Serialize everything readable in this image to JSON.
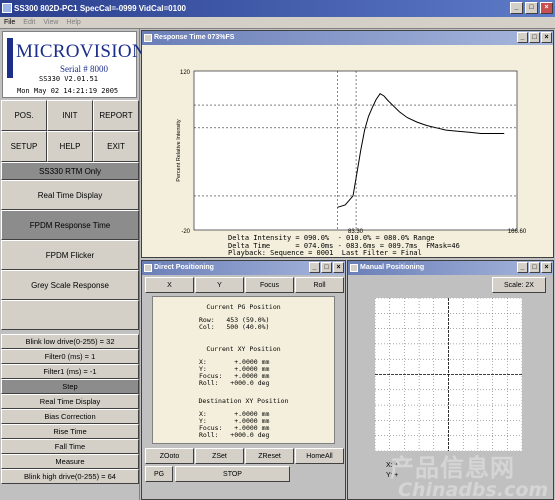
{
  "window": {
    "title": "SS300 802D-PC1  SpecCal=-0999 VidCal=0100"
  },
  "menu": [
    {
      "label": "File",
      "enabled": true
    },
    {
      "label": "Edit",
      "enabled": false
    },
    {
      "label": "View",
      "enabled": false
    },
    {
      "label": "Help",
      "enabled": false
    }
  ],
  "logo": {
    "brand": "MICROVISION",
    "serial": "Serial # 8000",
    "version": "SS330 V2.01.51",
    "datetime": "Mon May 02 14:21:19 2005"
  },
  "grid_buttons": [
    "POS.",
    "INIT",
    "REPORT",
    "SETUP",
    "HELP",
    "EXIT"
  ],
  "left_buttons": {
    "mode": "SS330 RTM Only",
    "realtime": "Real Time Display",
    "fpdm_response": "FPDM Response Time",
    "fpdm_flicker": "FPDM Flicker",
    "grey_scale": "Grey Scale Response",
    "blink_low": "Blink low drive(0-255) = 32",
    "filter0": "Filter0 (ms) = 1",
    "filter1": "Filter1 (ms) = -1",
    "step": "Step",
    "realtime2": "Real Time Display",
    "bias": "Bias Correction",
    "rise": "Rise Time",
    "fall": "Fall Time",
    "measure": "Measure",
    "blink_high": "Blink high drive(0-255) = 64"
  },
  "response_window": {
    "title": "Response Time  073%FS",
    "readout": [
      "Delta Intensity = 090.0%  - 010.0% = 080.0% Range",
      "Delta Time      = 074.0ms - 083.6ms = 009.7ms  FMask=46",
      "Playback: Sequence = 0001  Last Filter = Final"
    ]
  },
  "chart_data": {
    "type": "line",
    "title": "",
    "xlabel": "Time (milliseconds)",
    "ylabel": "Percent Relative Intensity",
    "xlim": [
      0,
      166.6
    ],
    "ylim": [
      -20,
      120
    ],
    "x_tick_labels": [
      "83.30",
      "166.60"
    ],
    "y_tick_labels": [
      "120",
      "-20"
    ],
    "reference_lines_y": [
      90,
      10,
      70
    ],
    "cursor_lines_x": [
      74,
      83.6
    ],
    "series": [
      {
        "x": [
          74,
          78,
          82,
          84,
          86,
          88,
          90,
          92,
          94,
          96,
          98,
          100,
          103,
          106,
          110,
          115,
          120,
          125,
          130,
          136,
          142,
          148,
          154,
          160
        ],
        "y": [
          0,
          2,
          10,
          30,
          50,
          68,
          80,
          88,
          95,
          100,
          98,
          94,
          89,
          84,
          79,
          75,
          72,
          70,
          68,
          67,
          66,
          65,
          65,
          65
        ]
      }
    ]
  },
  "direct_window": {
    "title": "Direct Positioning",
    "top_buttons": [
      "X",
      "Y",
      "Focus",
      "Roll"
    ],
    "pg_heading": "Current PG Position",
    "pg_lines": "Row:   453 (59.0%)\nCol:   500 (40.0%)",
    "xy_heading": "Current XY Position",
    "xy_lines": "X:       +.0000 mm\nY:       +.0000 mm\nFocus:   +.0000 mm\nRoll:   +000.0 deg",
    "dest_heading": "Destination XY Position",
    "dest_lines": "X:       +.0000 mm\nY:       +.0000 mm\nFocus:   +.0000 mm\nRoll:   +000.0 deg",
    "bottom_buttons": [
      "ZOoto",
      "ZSet",
      "ZReset",
      "HomeAll"
    ],
    "pg_button": "PG",
    "stop_button": "STOP"
  },
  "manual_window": {
    "title": "Manual Positioning",
    "scale_button": "Scale: 2X",
    "x_label": "X: +",
    "y_label": "Y: +"
  },
  "watermark": {
    "line1": "产品信息网",
    "line2": "Chinadbs.com"
  },
  "colors": {
    "title": "#2a3f8e",
    "brand": "#1a2e8a",
    "plot_bg": "#f3efdc"
  }
}
